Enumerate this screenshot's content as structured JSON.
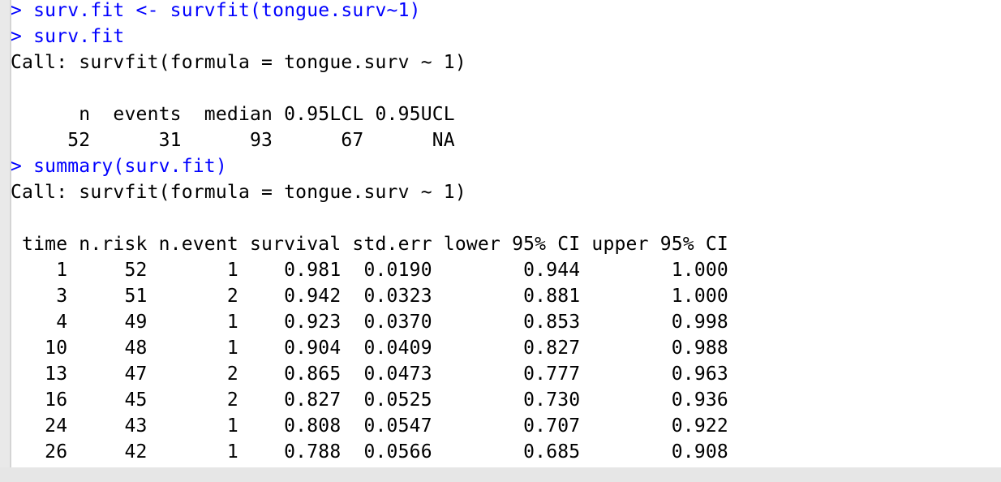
{
  "console": {
    "lines": [
      {
        "type": "input",
        "text": "> surv.fit <- survfit(tongue.surv~1)"
      },
      {
        "type": "input",
        "text": "> surv.fit"
      },
      {
        "type": "output",
        "text": "Call: survfit(formula = tongue.surv ~ 1)"
      },
      {
        "type": "output",
        "text": ""
      },
      {
        "type": "output",
        "text": "      n  events  median 0.95LCL 0.95UCL"
      },
      {
        "type": "output",
        "text": "     52      31      93      67      NA"
      },
      {
        "type": "input",
        "text": "> summary(surv.fit)"
      },
      {
        "type": "output",
        "text": "Call: survfit(formula = tongue.surv ~ 1)"
      },
      {
        "type": "output",
        "text": ""
      },
      {
        "type": "output",
        "text": " time n.risk n.event survival std.err lower 95% CI upper 95% CI"
      },
      {
        "type": "output",
        "text": "    1     52       1    0.981  0.0190        0.944        1.000"
      },
      {
        "type": "output",
        "text": "    3     51       2    0.942  0.0323        0.881        1.000"
      },
      {
        "type": "output",
        "text": "    4     49       1    0.923  0.0370        0.853        0.998"
      },
      {
        "type": "output",
        "text": "   10     48       1    0.904  0.0409        0.827        0.988"
      },
      {
        "type": "output",
        "text": "   13     47       2    0.865  0.0473        0.777        0.963"
      },
      {
        "type": "output",
        "text": "   16     45       2    0.827  0.0525        0.730        0.936"
      },
      {
        "type": "output",
        "text": "   24     43       1    0.808  0.0547        0.707        0.922"
      },
      {
        "type": "output",
        "text": "   26     42       1    0.788  0.0566        0.685        0.908"
      }
    ]
  }
}
